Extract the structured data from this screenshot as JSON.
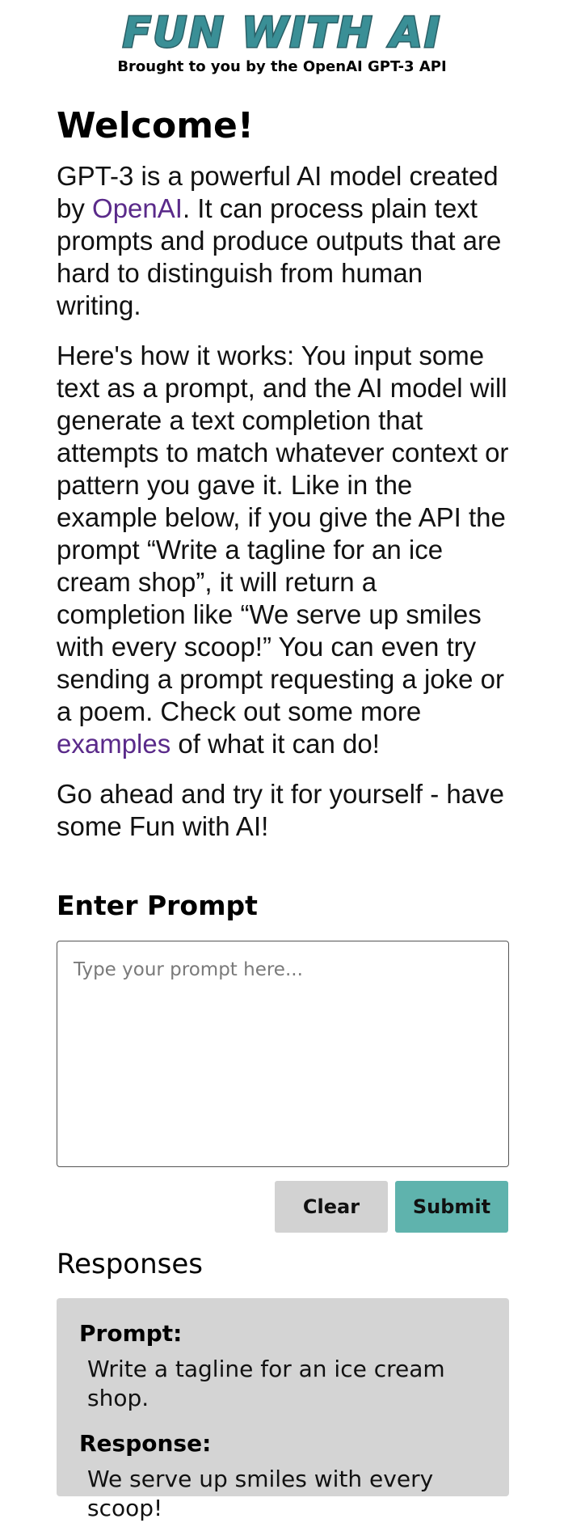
{
  "header": {
    "logo_text": "FUN WITH AI",
    "tagline": "Brought to you by the OpenAI GPT-3 API"
  },
  "intro": {
    "title": "Welcome!",
    "p1_before": "GPT-3 is a powerful AI model created by ",
    "p1_link": "OpenAI",
    "p1_after": ". It can process plain text prompts and produce outputs that are hard to distinguish from human writing.",
    "p2_before": "Here's how it works: You input some text as a prompt, and the AI model will generate a text completion that attempts to match whatever context or pattern you gave it. Like in the example below, if you give the API the prompt “Write a tagline for an ice cream shop”, it will return a completion like “We serve up smiles with every scoop!” You can even try sending a prompt requesting a joke or a poem. Check out some more ",
    "p2_link": "examples",
    "p2_after": " of what it can do!",
    "p3": "Go ahead and try it for yourself - have some Fun with AI!"
  },
  "prompt": {
    "heading": "Enter Prompt",
    "placeholder": "Type your prompt here...",
    "value": "",
    "clear_label": "Clear",
    "submit_label": "Submit"
  },
  "responses": {
    "heading": "Responses",
    "items": [
      {
        "prompt_label": "Prompt:",
        "prompt_text": "Write a tagline for an ice cream shop.",
        "response_label": "Response:",
        "response_text": "We serve up smiles with every scoop!"
      }
    ]
  },
  "colors": {
    "logo_fill": "#3a8f96",
    "logo_stroke": "#2a5f66",
    "link": "#5a2a8a",
    "submit_bg": "#5fb3ad",
    "clear_bg": "#d2d2d2",
    "card_bg": "#d4d4d4"
  }
}
